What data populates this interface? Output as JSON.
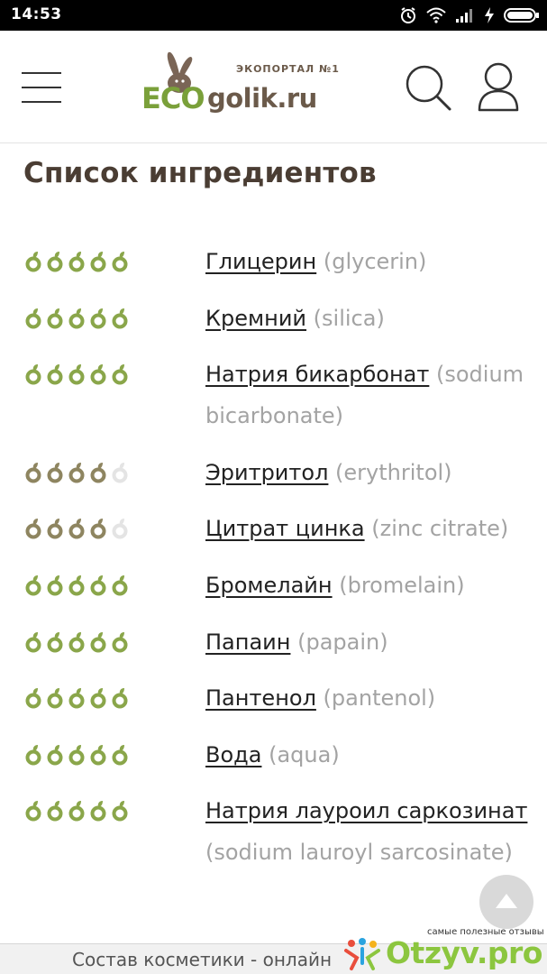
{
  "status_bar": {
    "time": "14:53"
  },
  "header": {
    "logo": {
      "tagline": "ЭКОПОРТАЛ №1",
      "eco": "ECO",
      "domain": "golik.ru"
    },
    "icons": {
      "menu": "hamburger-menu-icon",
      "search": "search-icon",
      "account": "user-icon"
    }
  },
  "page": {
    "title": "Список ингредиентов"
  },
  "colors": {
    "leaf_green": "#8aa64a",
    "leaf_olive": "#8e8560",
    "leaf_empty": "#e4e4e4",
    "title": "#4a3d33",
    "latin": "#a3a3a3",
    "otzyv_green": "#8cc63f"
  },
  "ingredients": [
    {
      "ru": "Глицерин",
      "en": "(glycerin)",
      "rating": 5,
      "max": 5
    },
    {
      "ru": "Кремний",
      "en": "(silica)",
      "rating": 5,
      "max": 5
    },
    {
      "ru": "Натрия бикарбонат",
      "en": "(sodium bicarbonate)",
      "rating": 5,
      "max": 5
    },
    {
      "ru": "Эритритол",
      "en": "(erythritol)",
      "rating": 4,
      "max": 5
    },
    {
      "ru": "Цитрат цинка",
      "en": "(zinc citrate)",
      "rating": 4,
      "max": 5
    },
    {
      "ru": "Бромелайн",
      "en": "(bromelain)",
      "rating": 5,
      "max": 5
    },
    {
      "ru": "Папаин",
      "en": "(papain)",
      "rating": 5,
      "max": 5
    },
    {
      "ru": "Пантенол",
      "en": "(pantenol)",
      "rating": 5,
      "max": 5
    },
    {
      "ru": "Вода",
      "en": "(aqua)",
      "rating": 5,
      "max": 5
    },
    {
      "ru": "Натрия лауроил саркозинат",
      "en": "(sodium lauroyl sarcosinate)",
      "rating": 5,
      "max": 5
    }
  ],
  "bottom_bar": {
    "caption": "Состав косметики - онлайн"
  },
  "watermark": {
    "tagline": "самые полезные отзывы",
    "brand": "Otzyv.pro"
  }
}
